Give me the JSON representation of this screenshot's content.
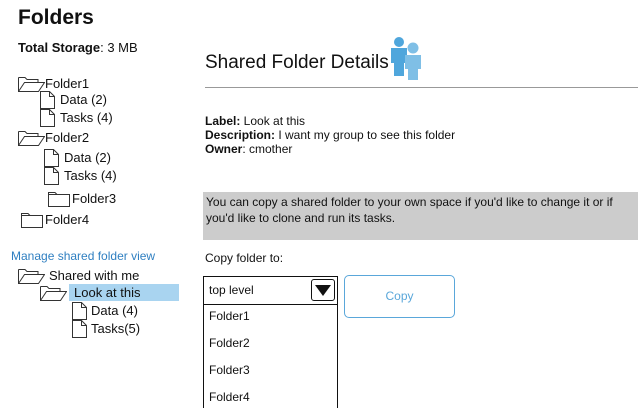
{
  "sidebar": {
    "title": "Folders",
    "storage_label": "Total Storage",
    "storage_value": ": 3 MB",
    "tree": {
      "folder1": "Folder1",
      "folder1_data": "Data (2)",
      "folder1_tasks": "Tasks (4)",
      "folder2": "Folder2",
      "folder2_data": "Data (2)",
      "folder2_tasks": "Tasks (4)",
      "folder3": "Folder3",
      "folder4": "Folder4"
    },
    "manage_link": "Manage shared folder view",
    "shared_tree": {
      "shared_with_me": "Shared with me",
      "look_at_this": "Look at this",
      "data": "Data (4)",
      "tasks": "Tasks(5)"
    }
  },
  "main": {
    "title": "Shared Folder Details",
    "icon": "people-icon",
    "details": {
      "label_key": "Label:",
      "label_value": " Look at this",
      "description_key": "Description:",
      "description_value": " I want my group to see this folder",
      "owner_key": "Owner",
      "owner_value": ": cmother"
    },
    "notice": "You can copy a shared folder to your own space if you'd like to change it or if you'd like to clone and run its tasks.",
    "copy_to_label": "Copy folder to:",
    "dropdown": {
      "selected": "top level",
      "options": [
        "Folder1",
        "Folder2",
        "Folder3",
        "Folder4"
      ]
    },
    "copy_button": "Copy"
  },
  "colors": {
    "link": "#2f7fc1",
    "highlight": "#a9d4f0",
    "notice_bg": "#cccccc",
    "button_border": "#5aa7da",
    "people_icon": "#4fa6dc"
  }
}
